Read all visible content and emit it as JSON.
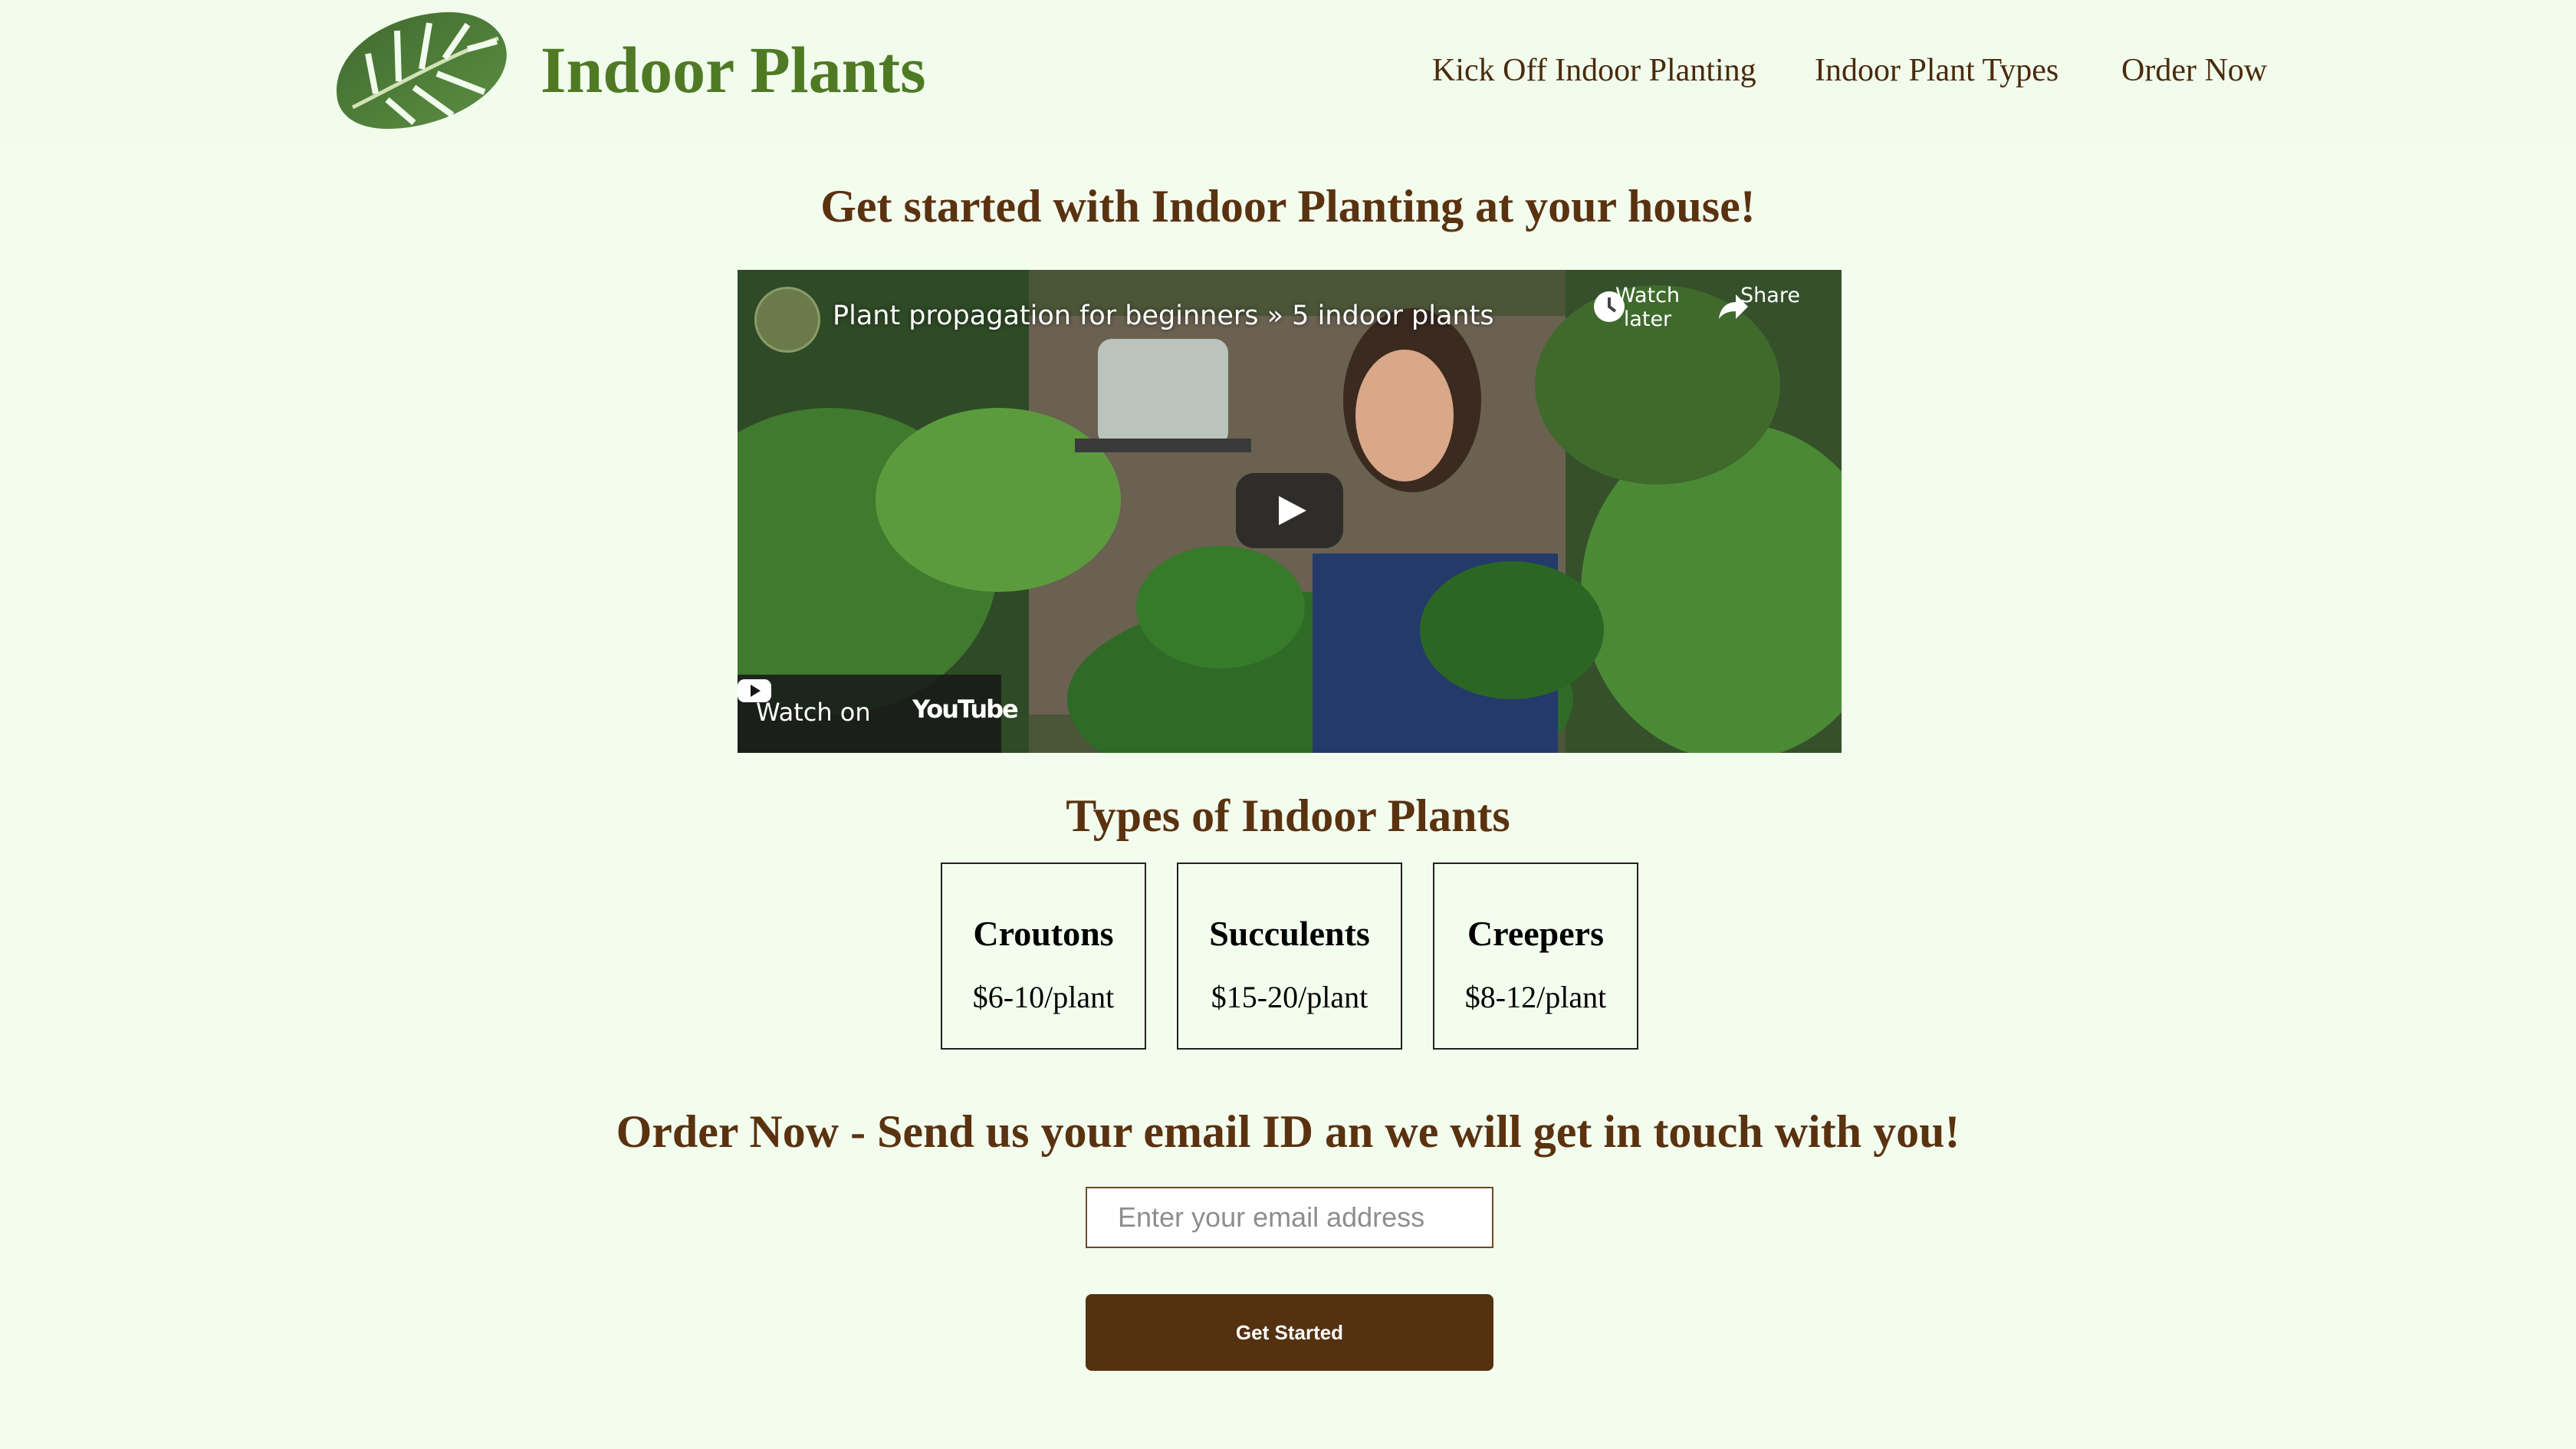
{
  "header": {
    "brand": "Indoor Plants",
    "logo_icon": "monstera-leaf-icon",
    "nav": [
      {
        "label": "Kick Off Indoor Planting"
      },
      {
        "label": "Indoor Plant Types"
      },
      {
        "label": "Order Now"
      }
    ]
  },
  "intro": {
    "heading": "Get started with Indoor Planting at your house!"
  },
  "video": {
    "title": "Plant propagation for beginners » 5 indoor plants",
    "watch_later": "Watch later",
    "share": "Share",
    "watch_on": "Watch on",
    "youtube": "YouTube"
  },
  "types": {
    "heading": "Types of Indoor Plants",
    "cards": [
      {
        "name": "Croutons",
        "price": "$6-10/plant"
      },
      {
        "name": "Succulents",
        "price": "$15-20/plant"
      },
      {
        "name": "Creepers",
        "price": "$8-12/plant"
      }
    ]
  },
  "order": {
    "heading": "Order Now - Send us your email ID an we will get in touch with you!",
    "email_placeholder": "Enter your email address",
    "email_value": "",
    "button_label": "Get Started"
  },
  "colors": {
    "page_bg": "#f3fdee",
    "brand_green": "#4f7a23",
    "heading_brown": "#5a3210",
    "button_brown": "#54310f"
  }
}
